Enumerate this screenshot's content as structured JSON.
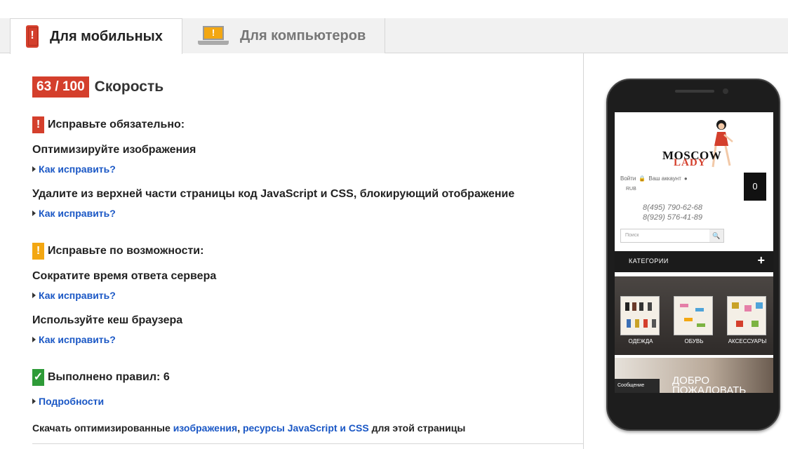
{
  "tabs": {
    "mobile_label": "Для мобильных",
    "mobile_icon_glyph": "!",
    "desktop_label": "Для компьютеров",
    "desktop_icon_glyph": "!"
  },
  "score": {
    "value": "63 / 100",
    "label": "Скорость"
  },
  "must_fix": {
    "icon_glyph": "!",
    "title": "Исправьте обязательно:",
    "rules": [
      {
        "title": "Оптимизируйте изображения",
        "link": "Как исправить?"
      },
      {
        "title": "Удалите из верхней части страницы код JavaScript и CSS, блокирующий отображение",
        "link": "Как исправить?"
      }
    ]
  },
  "consider_fix": {
    "icon_glyph": "!",
    "title": "Исправьте по возможности:",
    "rules": [
      {
        "title": "Сократите время ответа сервера",
        "link": "Как исправить?"
      },
      {
        "title": "Используйте кеш браузера",
        "link": "Как исправить?"
      }
    ]
  },
  "passed": {
    "icon_glyph": "✓",
    "title": "Выполнено правил: 6",
    "link": "Подробности"
  },
  "download": {
    "prefix": "Скачать оптимизированные ",
    "link1": "изображения",
    "sep": ", ",
    "link2": "ресурсы JavaScript и CSS",
    "suffix": " для этой страницы"
  },
  "preview": {
    "logo_line1": "MOSCOW",
    "logo_line2": "LADY",
    "login": "Войти",
    "account": "Ваш аккаунт",
    "currency": "RUB",
    "cart_count": "0",
    "phone1": "8(495) 790-62-68",
    "phone2": "8(929) 576-41-89",
    "search_placeholder": "Поиск",
    "categories": "КАТЕГОРИИ",
    "categories_plus": "+",
    "cat_clothes": "ОДЕЖДА",
    "cat_shoes": "ОБУВЬ",
    "cat_accessories": "АКСЕССУАРЫ",
    "chat": "Сообщение",
    "welcome_line1": "ДОБРО",
    "welcome_line2": "ПОЖАЛОВАТЬ"
  },
  "colors": {
    "error_red": "#d43f2c",
    "warning_orange": "#f3a712",
    "success_green": "#2e9b38",
    "link_blue": "#1a57c5"
  }
}
